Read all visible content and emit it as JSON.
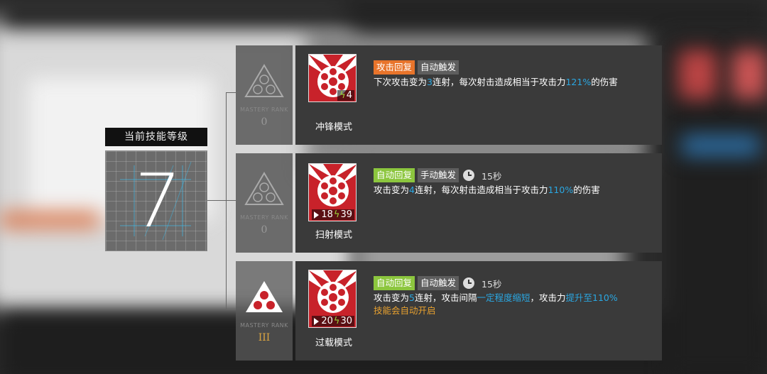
{
  "level_panel": {
    "title": "当前技能等级",
    "value": "7"
  },
  "skills": [
    {
      "mastery_label": "MASTERY RANK",
      "mastery_level": "0",
      "mastery_active": false,
      "name": "冲锋模式",
      "sp_cost": "4",
      "initial_sp": "",
      "tags": [
        {
          "text": "攻击回复",
          "color": "#e8742b"
        },
        {
          "text": "自动触发",
          "color": "#5e5e5e"
        }
      ],
      "duration": "",
      "desc_parts": [
        {
          "text": "下次攻击变为",
          "hl": false
        },
        {
          "text": "3",
          "hl": true
        },
        {
          "text": "连射，每次射击造成相当于攻击力",
          "hl": false
        },
        {
          "text": "121%",
          "hl": true
        },
        {
          "text": "的伤害",
          "hl": false
        }
      ],
      "note": ""
    },
    {
      "mastery_label": "MASTERY RANK",
      "mastery_level": "0",
      "mastery_active": false,
      "name": "扫射模式",
      "sp_cost": "39",
      "initial_sp": "18",
      "tags": [
        {
          "text": "自动回复",
          "color": "#8cc63e"
        },
        {
          "text": "手动触发",
          "color": "#5e5e5e"
        }
      ],
      "duration": "15秒",
      "desc_parts": [
        {
          "text": "攻击变为",
          "hl": false
        },
        {
          "text": "4",
          "hl": true
        },
        {
          "text": "连射，每次射击造成相当于攻击力",
          "hl": false
        },
        {
          "text": "110%",
          "hl": true
        },
        {
          "text": "的伤害",
          "hl": false
        }
      ],
      "note": ""
    },
    {
      "mastery_label": "MASTERY RANK",
      "mastery_level": "III",
      "mastery_active": true,
      "name": "过载模式",
      "sp_cost": "30",
      "initial_sp": "20",
      "tags": [
        {
          "text": "自动回复",
          "color": "#8cc63e"
        },
        {
          "text": "自动触发",
          "color": "#5e5e5e"
        }
      ],
      "duration": "15秒",
      "desc_parts": [
        {
          "text": "攻击变为",
          "hl": false
        },
        {
          "text": "5",
          "hl": true
        },
        {
          "text": "连射，攻击间隔",
          "hl": false
        },
        {
          "text": "一定程度缩短",
          "hl": true
        },
        {
          "text": "，攻击力",
          "hl": false
        },
        {
          "text": "提升至110%",
          "hl": true
        }
      ],
      "note": "技能会自动开启"
    }
  ],
  "icons": {
    "mastery": "mastery-triangle-icon",
    "skill": "revolver-cylinder-icon",
    "clock": "clock-icon",
    "sp": "lightning-bolt-icon",
    "initial": "play-triangle-icon"
  },
  "colors": {
    "accent_blue": "#2aa7e2",
    "note_orange": "#e8a12f",
    "skill_red": "#c8222a"
  }
}
